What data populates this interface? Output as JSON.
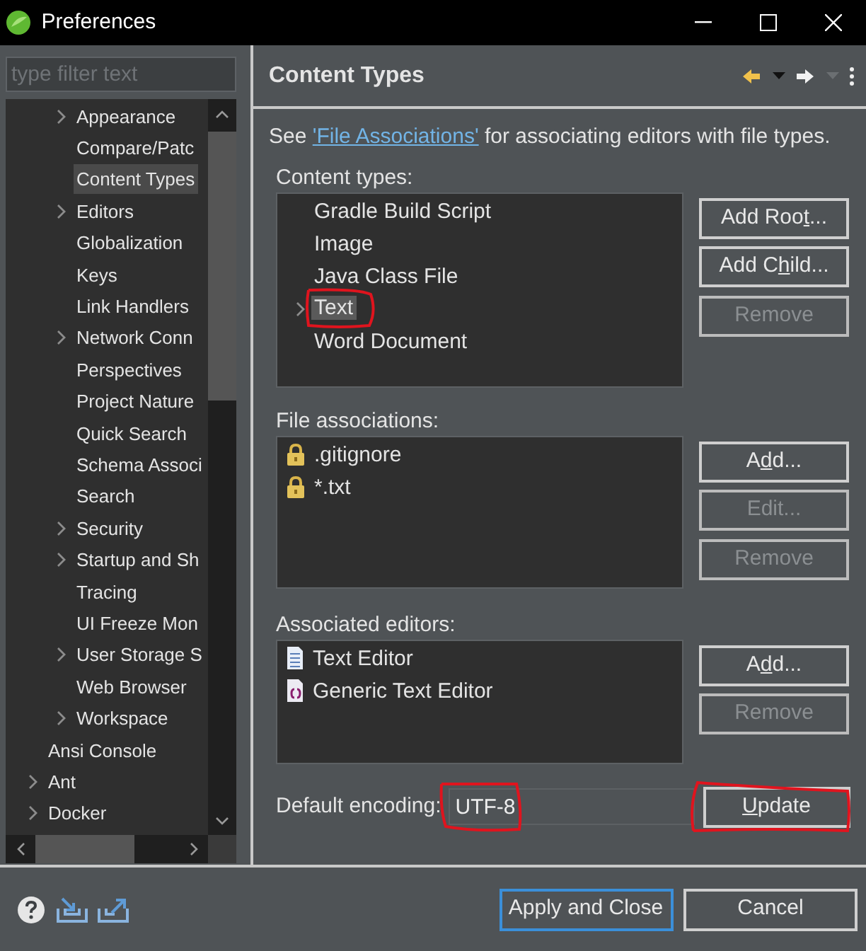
{
  "window": {
    "title": "Preferences"
  },
  "filter": {
    "placeholder": "type filter text"
  },
  "sidebar": {
    "items": [
      {
        "children": [
          {
            "label": "Appearance",
            "expanded": false,
            "selected": false
          },
          {
            "label": "Compare/Patc",
            "selected": false
          },
          {
            "label": "Content Types",
            "selected": true
          },
          {
            "label": "Editors",
            "expanded": false,
            "selected": false
          },
          {
            "label": "Globalization",
            "selected": false
          },
          {
            "label": "Keys",
            "selected": false
          },
          {
            "label": "Link Handlers",
            "selected": false
          },
          {
            "label": "Network Conn",
            "expanded": false,
            "selected": false
          },
          {
            "label": "Perspectives",
            "selected": false
          },
          {
            "label": "Project Nature",
            "selected": false
          },
          {
            "label": "Quick Search",
            "selected": false
          },
          {
            "label": "Schema Associ",
            "selected": false
          },
          {
            "label": "Search",
            "selected": false
          },
          {
            "label": "Security",
            "expanded": false,
            "selected": false
          },
          {
            "label": "Startup and Sh",
            "expanded": false,
            "selected": false
          },
          {
            "label": "Tracing",
            "selected": false
          },
          {
            "label": "UI Freeze Mon",
            "selected": false
          },
          {
            "label": "User Storage S",
            "expanded": false,
            "selected": false
          },
          {
            "label": "Web Browser",
            "selected": false
          },
          {
            "label": "Workspace",
            "expanded": false,
            "selected": false
          }
        ]
      },
      {
        "label": "Ansi Console",
        "selected": false
      },
      {
        "label": "Ant",
        "expanded": false,
        "selected": false
      },
      {
        "label": "Docker",
        "expanded": false,
        "selected": false
      }
    ]
  },
  "page": {
    "title": "Content Types",
    "intro_before": "See ",
    "intro_link": "'File Associations'",
    "intro_after": " for associating editors with file types.",
    "sections": [
      {
        "label": "Content types:",
        "items": [
          {
            "text": "Gradle Build Script",
            "selected": false
          },
          {
            "text": "Image",
            "selected": false
          },
          {
            "text": "Java Class File",
            "selected": false
          },
          {
            "text": "Text",
            "expanded": false,
            "selected": true,
            "circled": true
          },
          {
            "text": "Word Document",
            "selected": false
          }
        ],
        "buttons": [
          {
            "label": "Add Roo",
            "mnemonic": "t",
            "label_after": "...",
            "disabled": false
          },
          {
            "label": "Add C",
            "mnemonic": "h",
            "label_after": "ild...",
            "disabled": false
          },
          {
            "label": "Remove",
            "disabled": true
          }
        ]
      },
      {
        "label": "File associations:",
        "items": [
          {
            "text": ".gitignore",
            "kind": "locked",
            "selected": false
          },
          {
            "text": "*.txt",
            "kind": "locked",
            "selected": false
          }
        ],
        "buttons": [
          {
            "label": "A",
            "mnemonic": "d",
            "label_after": "d...",
            "disabled": false
          },
          {
            "label": "Edit...",
            "disabled": true
          },
          {
            "label": "Remove",
            "disabled": true
          }
        ]
      },
      {
        "label": "Associated editors:",
        "items": [
          {
            "text": "Text Editor",
            "kind": "text-editor",
            "selected": false
          },
          {
            "text": "Generic Text Editor",
            "kind": "generic-editor",
            "selected": false
          }
        ],
        "buttons": [
          {
            "label": "A",
            "mnemonic": "d",
            "label_after": "d...",
            "disabled": false
          },
          {
            "label": "Remove",
            "disabled": true
          }
        ]
      }
    ],
    "encoding": {
      "label": "Default encoding:",
      "value": "UTF-8",
      "circled": true
    },
    "update_button": {
      "mnemonic": "U",
      "label_after": "pdate",
      "circled": true
    }
  },
  "footer": {
    "buttons": [
      {
        "label": "Apply and Close",
        "default": true
      },
      {
        "label": "Cancel",
        "default": false
      }
    ]
  }
}
